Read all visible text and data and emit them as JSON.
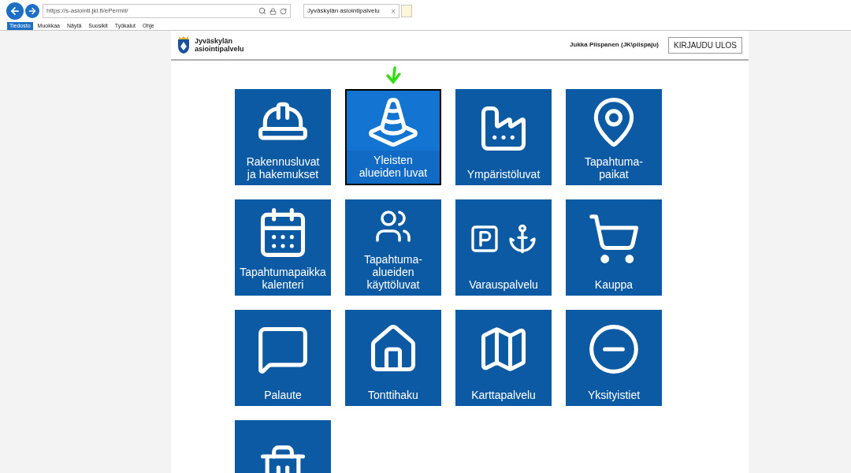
{
  "browser": {
    "url": "https://s-asiointi.jkl.fi/ePermit/",
    "tab_title": "Jyväskylän asiointipalvelu",
    "tab_close": "×",
    "menu": [
      {
        "label": "Tiedosto",
        "selected": true
      },
      {
        "label": "Muokkaa",
        "selected": false
      },
      {
        "label": "Näytä",
        "selected": false
      },
      {
        "label": "Suosikit",
        "selected": false
      },
      {
        "label": "Työkalut",
        "selected": false
      },
      {
        "label": "Ohje",
        "selected": false
      }
    ]
  },
  "header": {
    "logo_line_1": "Jyväskylän",
    "logo_line_2": "asiointipalvelu",
    "user": "Jukka Piispanen (JK\\piispaju)",
    "logout": "KIRJAUDU ULOS"
  },
  "tiles": [
    {
      "label_lines": [
        "Rakennusluvat",
        "ja hakemukset"
      ],
      "selected": false
    },
    {
      "label_lines": [
        "Yleisten",
        "alueiden luvat"
      ],
      "selected": true
    },
    {
      "label_lines": [
        "Ympäristöluvat"
      ],
      "selected": false
    },
    {
      "label_lines": [
        "Tapahtuma-",
        "paikat"
      ],
      "selected": false
    },
    {
      "label_lines": [
        "Tapahtumapaikka",
        "kalenteri"
      ],
      "selected": false
    },
    {
      "label_lines": [
        "Tapahtuma-",
        "alueiden",
        "käyttöluvat"
      ],
      "selected": false
    },
    {
      "label_lines": [
        "Varauspalvelu"
      ],
      "selected": false
    },
    {
      "label_lines": [
        "Kauppa"
      ],
      "selected": false
    },
    {
      "label_lines": [
        "Palaute"
      ],
      "selected": false
    },
    {
      "label_lines": [
        "Tonttihaku"
      ],
      "selected": false
    },
    {
      "label_lines": [
        "Karttapalvelu"
      ],
      "selected": false
    },
    {
      "label_lines": [
        "Yksityistiet"
      ],
      "selected": false
    },
    {
      "selected": false
    }
  ]
}
